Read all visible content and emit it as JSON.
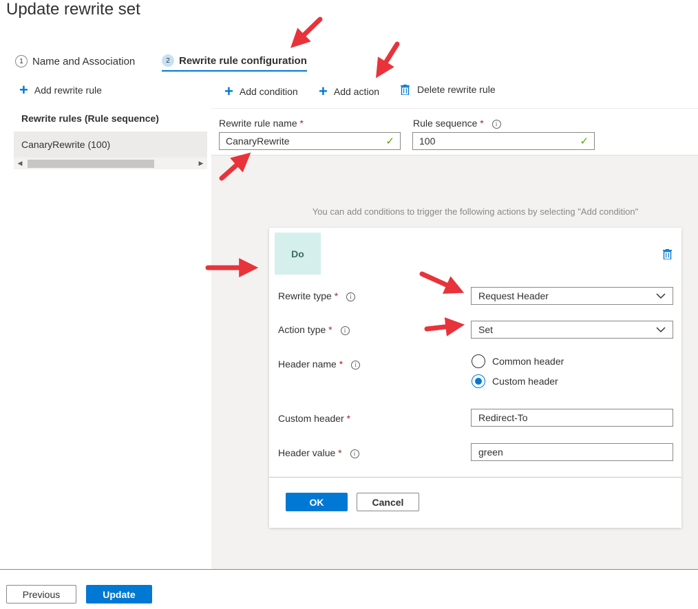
{
  "page": {
    "title": "Update rewrite set"
  },
  "tabs": [
    {
      "num": "1",
      "label": "Name and Association"
    },
    {
      "num": "2",
      "label": "Rewrite rule configuration"
    }
  ],
  "left_pane": {
    "add_rule_label": "Add rewrite rule",
    "rules_heading": "Rewrite rules (Rule sequence)",
    "rules": [
      "CanaryRewrite (100)"
    ]
  },
  "toolbar": {
    "add_condition": "Add condition",
    "add_action": "Add action",
    "delete_rule": "Delete rewrite rule"
  },
  "rule_fields": {
    "name_label": "Rewrite rule name",
    "name_value": "CanaryRewrite",
    "seq_label": "Rule sequence",
    "seq_value": "100"
  },
  "hint": "You can add conditions to trigger the following actions by selecting \"Add condition\"",
  "action_card": {
    "badge": "Do",
    "rewrite_type_label": "Rewrite type",
    "rewrite_type_value": "Request Header",
    "action_type_label": "Action type",
    "action_type_value": "Set",
    "header_name_label": "Header name",
    "header_options": [
      "Common header",
      "Custom header"
    ],
    "header_selected": "Custom header",
    "custom_header_label": "Custom header",
    "custom_header_value": "Redirect-To",
    "header_value_label": "Header value",
    "header_value_value": "green",
    "ok": "OK",
    "cancel": "Cancel"
  },
  "footer": {
    "previous": "Previous",
    "update": "Update"
  },
  "required_mark": "*",
  "info_glyph": "i",
  "colors": {
    "accent": "#0078d4",
    "arrow": "#e8333a",
    "required": "#a4262c",
    "valid": "#57a300",
    "do_badge": "#d5f0ec"
  },
  "icons": [
    "plus-icon",
    "trash-icon",
    "chevron-down-icon",
    "check-icon",
    "info-icon",
    "scroll-left-icon",
    "scroll-right-icon",
    "red-arrow-annotation"
  ]
}
